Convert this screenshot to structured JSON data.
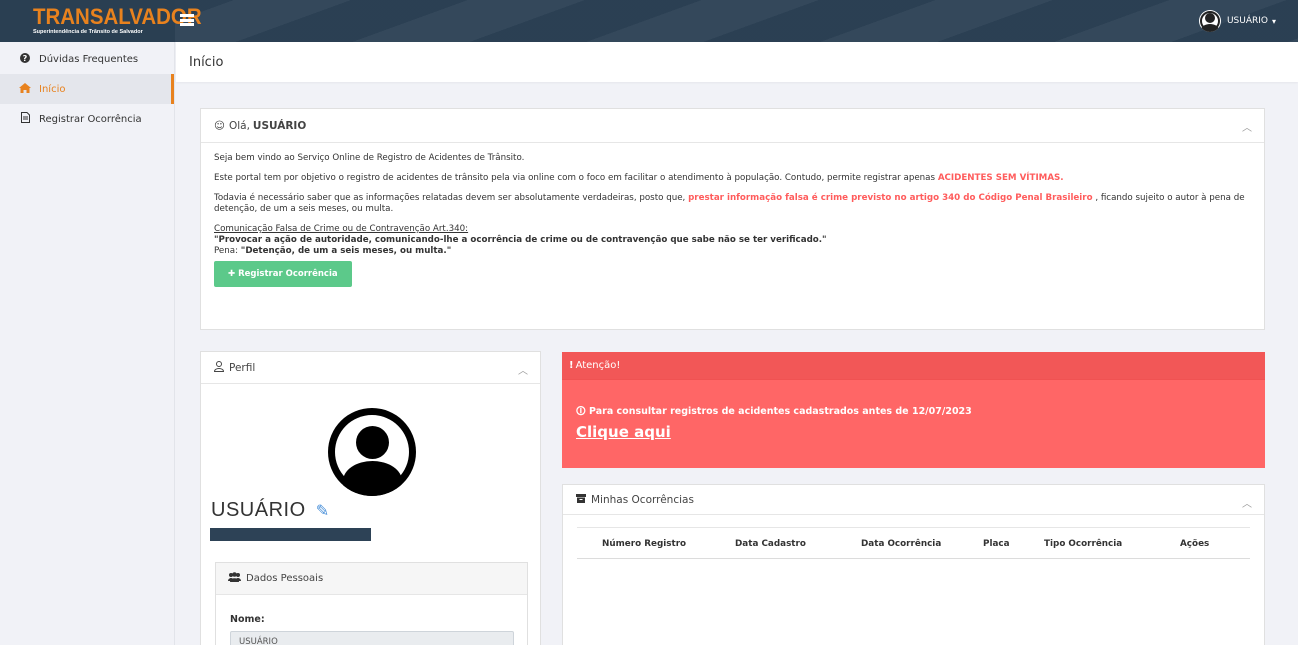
{
  "header": {
    "brand_name": "TRANSALVADOR",
    "brand_subtitle": "Superintendência de Trânsito de Salvador",
    "user_name": "USUÁRIO",
    "caret": "▾"
  },
  "sidebar": {
    "items": [
      {
        "label": "Dúvidas Frequentes",
        "icon": "question-circle-icon",
        "glyph": "❓"
      },
      {
        "label": "Início",
        "icon": "home-icon",
        "glyph": "⌂"
      },
      {
        "label": "Registrar Ocorrência",
        "icon": "document-icon",
        "glyph": "🗎"
      }
    ]
  },
  "page": {
    "title": "Início"
  },
  "welcome": {
    "greeting": "Olá,",
    "greeting_name": "USUÁRIO",
    "intro": "Seja bem vindo ao Serviço Online de Registro de Acidentes de Trânsito.",
    "purpose_text": "Este portal tem por objetivo o registro de acidentes de trânsito pela via online com o foco em facilitar o atendimento à população. Contudo, permite registrar apenas",
    "purpose_highlight": "ACIDENTES SEM VÍTIMAS.",
    "warning_start": "Todavia é necessário saber que as informações relatadas devem ser absolutamente verdadeiras, posto que,",
    "warning_highlight": "prestar informação falsa é crime previsto no artigo 340 do Código Penal Brasileiro",
    "warning_end": ", ficando sujeito o autor à pena de detenção, de um a seis meses, ou multa.",
    "law_title": "Comunicação Falsa de Crime ou de Contravenção Art.340:",
    "law_quote": "\"Provocar a ação de autoridade, comunicando-lhe a ocorrência de crime ou de contravenção que sabe não se ter verificado.\"",
    "penalty_label": "Pena:",
    "penalty_text": "\"Detenção, de um a seis meses, ou multa.\"",
    "register_button": "Registrar Ocorrência"
  },
  "profile": {
    "title": "Perfil",
    "user_name": "USUÁRIO",
    "dados_title": "Dados Pessoais",
    "name_label": "Nome:",
    "name_value": "USUÁRIO"
  },
  "alert": {
    "title": "Atenção!",
    "message_start": "Para consultar registros de acidentes cadastrados antes de",
    "message_date": "12/07/2023",
    "link": "Clique aqui",
    "color": "#ff6666"
  },
  "occurrences": {
    "title": "Minhas Ocorrências",
    "columns": [
      "Número Registro",
      "Data Cadastro",
      "Data Ocorrência",
      "Placa",
      "Tipo Ocorrência",
      "Ações"
    ],
    "rows": []
  },
  "colors": {
    "brand_orange": "#e8821e",
    "topbar": "#2d4256",
    "success_green": "#5cc98a",
    "danger_red": "#ff5c5c"
  }
}
